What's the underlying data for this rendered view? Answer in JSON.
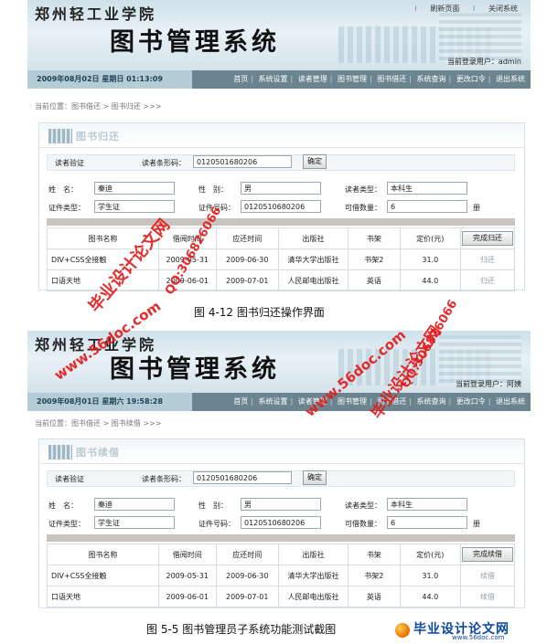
{
  "header": {
    "school": "郑州轻工业学院",
    "system_name": "图书管理系统",
    "link_refresh": "刷新页面",
    "link_close": "关闭系统",
    "current_user_1": "当前登录用户：admin",
    "current_user_2": "当前登录用户：阿姨"
  },
  "nav": {
    "date_1": "2009年08月02日  星期日  01:13:09",
    "date_2": "2009年08月01日  星期六  19:58:28",
    "menu": [
      "首页",
      "系统设置",
      "读者管理",
      "图书管理",
      "图书借还",
      "系统查询",
      "更改口令",
      "退出系统"
    ]
  },
  "screen1": {
    "breadcrumb": "当前位置：图书借还 > 图书归还 >>>",
    "title": "图书归还",
    "action_header": "完成归还",
    "action_text": "归还"
  },
  "screen2": {
    "breadcrumb": "当前位置：图书借还 > 图书续借 >>>",
    "title": "图书续借",
    "action_header": "完成续借",
    "action_text": "续借"
  },
  "reader": {
    "section": "读者验证",
    "barcode_label": "读者条形码：",
    "barcode": "0120501680206",
    "confirm": "确定",
    "name_label": "姓　名：",
    "name": "秦迪",
    "gender_label": "性　别：",
    "gender": "男",
    "type_label": "读者类型：",
    "type": "本科生",
    "cert_type_label": "证件类型：",
    "cert_type": "学生证",
    "cert_no_label": "证件号码：",
    "cert_no": "0120510680206",
    "quota_label": "可借数量：",
    "quota": "6",
    "quota_unit": "册"
  },
  "table": {
    "headers": [
      "图书名称",
      "借阅时间",
      "应还时间",
      "出版社",
      "书架",
      "定价(元)"
    ],
    "screen1_rows": [
      [
        "DIV+CSS全接触",
        "2009-05-31",
        "2009-06-30",
        "清华大学出版社",
        "书架2",
        "31.0"
      ],
      [
        "口语天地",
        "2009-06-01",
        "2009-07-01",
        "人民邮电出版社",
        "英语",
        "44.0"
      ]
    ],
    "screen2_rows": [
      [
        "DIV+CSS全接触",
        "2009-05-31",
        "2009-06-30",
        "清华大学出版社",
        "书架2",
        "31.0"
      ],
      [
        "口语天地",
        "2009-06-01",
        "2009-07-01",
        "人民邮电出版社",
        "英语",
        "44.0"
      ]
    ]
  },
  "captions": {
    "fig1": "图 4-12  图书归还操作界面",
    "fig2": "图 5-5  图书管理员子系统功能测试截图"
  },
  "watermarks": {
    "site_cn": "毕业设计论文网",
    "site_url": "www.56doc.com",
    "qq": "QQ:306826066",
    "logo_url": "www.56doc.com"
  }
}
